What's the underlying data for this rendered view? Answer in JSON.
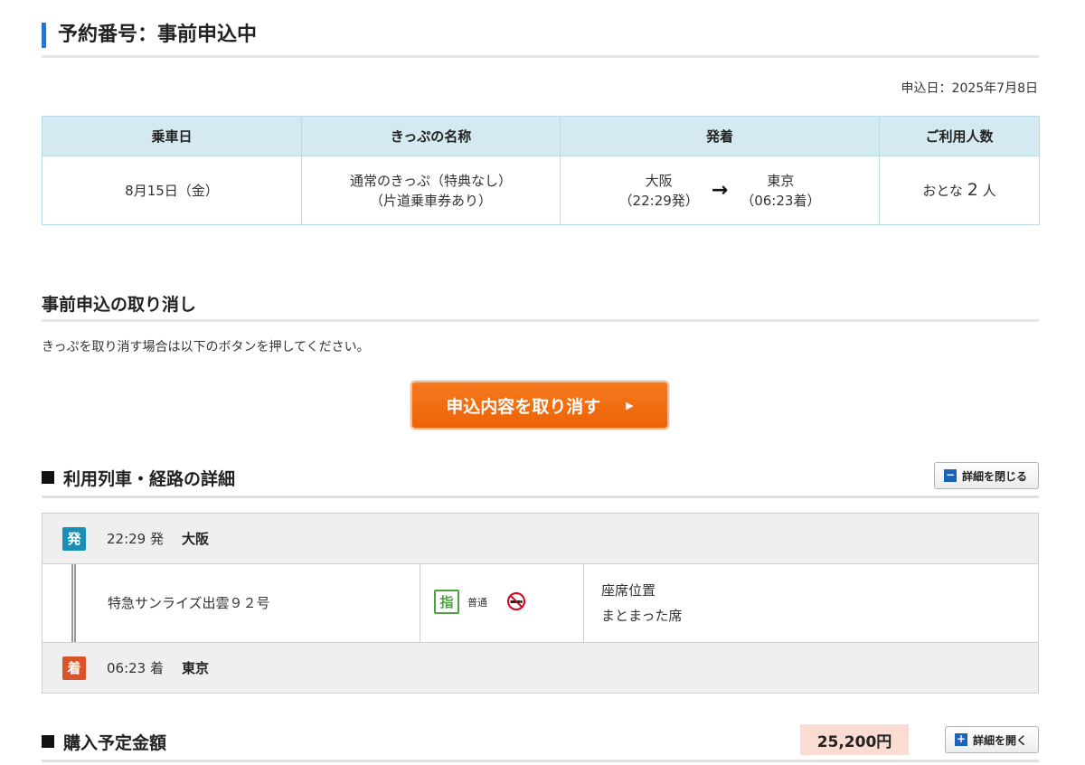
{
  "page": {
    "title": "予約番号：事前申込中",
    "apply_date": "申込日：2025年7月8日"
  },
  "summary": {
    "headers": [
      "乗車日",
      "きっぷの名称",
      "発着",
      "ご利用人数"
    ],
    "ride_date": "8月15日（金）",
    "ticket_name_line1": "通常のきっぷ（特典なし）",
    "ticket_name_line2": "（片道乗車券あり）",
    "from_station": "大阪",
    "from_time": "（22:29発）",
    "to_station": "東京",
    "to_time": "（06:23着）",
    "arrow": "→",
    "people_prefix": "おとな",
    "people_count": "2",
    "people_suffix": "人"
  },
  "cancel": {
    "heading": "事前申込の取り消し",
    "description": "きっぷを取り消す場合は以下のボタンを押してください。",
    "button_label": "申込内容を取り消す",
    "button_arrow": "▶"
  },
  "route_detail": {
    "heading": "利用列車・経路の詳細",
    "toggle_label": "詳細を閉じる",
    "toggle_icon": "−",
    "departure": {
      "badge": "発",
      "time": "22:29 発",
      "station": "大阪"
    },
    "train": {
      "name": "特急サンライズ出雲９２号",
      "reserved_badge": "指",
      "car_class": "普通",
      "seat_label": "座席位置",
      "seat_value": "まとまった席"
    },
    "arrival": {
      "badge": "着",
      "time": "06:23 着",
      "station": "東京"
    }
  },
  "price": {
    "heading": "購入予定金額",
    "amount": "25,200円",
    "toggle_label": "詳細を開く",
    "toggle_icon": "+"
  },
  "colors": {
    "title_bar": "#2c73c9",
    "table_header": "#d5eaf0",
    "cancel_button": "#f06a0f",
    "departure_badge": "#1a8fb5",
    "arrival_badge": "#d9542b",
    "reserved_badge": "#4aa33c",
    "price_badge": "#fadcd3"
  },
  "icons": [
    "no-smoking-icon",
    "minus-icon",
    "plus-icon",
    "chevron-right-icon"
  ]
}
